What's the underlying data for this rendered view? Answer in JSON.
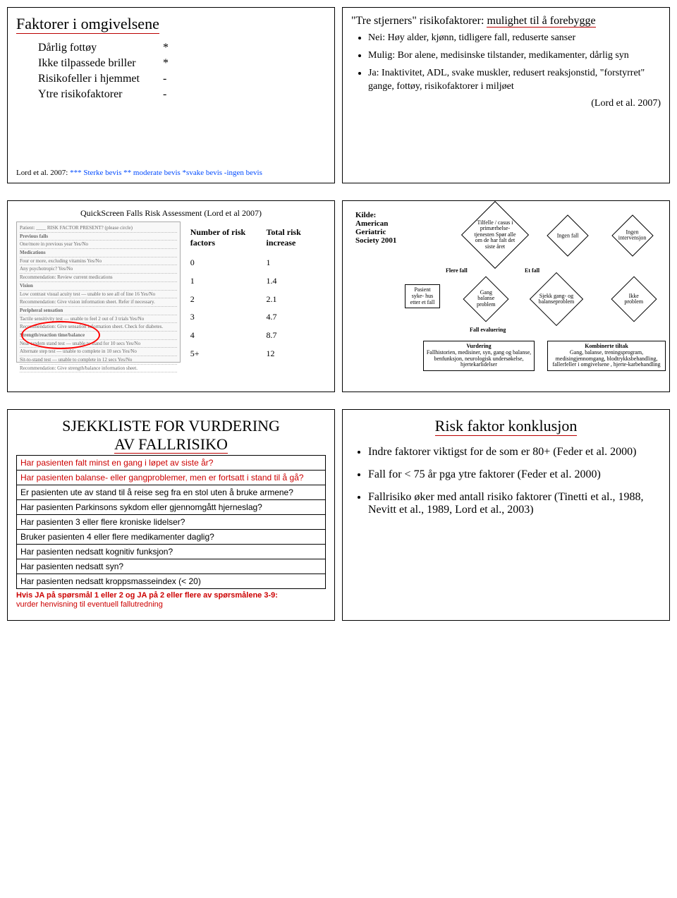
{
  "s1": {
    "title": "Faktorer i omgivelsene",
    "rows": [
      {
        "l": "Dårlig fottøy",
        "m": "*"
      },
      {
        "l": "Ikke tilpassede briller",
        "m": "*"
      },
      {
        "l": "Risikofeller i hjemmet",
        "m": "-"
      },
      {
        "l": "Ytre risikofaktorer",
        "m": "-"
      }
    ],
    "legend_a": "Lord et al. 2007: ",
    "legend_b": "*** Sterke bevis  ** moderate bevis  *svake bevis -ingen bevis"
  },
  "s2": {
    "title_pre": "\"Tre stjerners\" risikofaktorer: ",
    "title_ul": "mulighet til å forebygge",
    "items": [
      "Nei: Høy alder, kjønn, tidligere fall, reduserte sanser",
      "Mulig: Bor alene, medisinske tilstander, medikamenter, dårlig syn",
      "Ja: Inaktivitet, ADL, svake muskler, redusert reaksjonstid, \"forstyrret\" gange, fottøy, risikofaktorer i miljøet"
    ],
    "cite": "(Lord et al. 2007)"
  },
  "s3": {
    "title": "QuickScreen Falls Risk Assessment (Lord et al 2007)",
    "head_a": "Number of risk factors",
    "head_b": "Total risk increase",
    "chart_data": {
      "type": "table",
      "title": "QuickScreen Falls Risk Assessment — risk increase by number of risk factors",
      "xlabel": "Number of risk factors",
      "ylabel": "Total risk increase",
      "categories": [
        "0",
        "1",
        "2",
        "3",
        "4",
        "5+"
      ],
      "values": [
        1.0,
        1.4,
        2.1,
        4.7,
        8.7,
        12
      ]
    }
  },
  "s4": {
    "kilde": "Kilde: American Geriatric Society 2001",
    "d1": "Tilfelle / casus i primærhelse-\ntjenesten\nSpør alle om de har falt det siste året",
    "d2": "Ingen fall",
    "d3": "Ingen intervensjon",
    "l_flere": "Flere fall",
    "l_et": "Et fall",
    "b_pas": "Pasient syke-\nhus etter et  fall",
    "d4": "Gang balanse problem",
    "d5": "Sjekk gang- og balanseproblem",
    "d6": "Ikke problem",
    "l_fall": "Fall evaluering",
    "b_vur_t": "Vurdering",
    "b_vur": "Fallhistorien, medisiner, syn, gang og balanse, benfunksjon, neurologisk undersøkelse, hjertekarlidelser",
    "b_kom_t": "Kombinerte tiltak",
    "b_kom": "Gang, balanse, treningsprogram, medisingjennomgang, blodtrykksbehandling, fallerfeller i omgivelsene , hjerte-karbehandling"
  },
  "s5": {
    "title_a": "SJEKKLISTE FOR VURDERING",
    "title_b": "AV FALLRISIKO",
    "rows": [
      {
        "t": "Har pasienten falt minst en gang i løpet av siste år?",
        "red": true
      },
      {
        "t": "Har pasienten balanse- eller gangproblemer, men er fortsatt i stand til å gå?",
        "red": true
      },
      {
        "t": "Er pasienten ute av stand til å reise seg fra en stol uten å bruke armene?",
        "red": false
      },
      {
        "t": "Har pasienten Parkinsons sykdom eller gjennomgått hjerneslag?",
        "red": false
      },
      {
        "t": "Har pasienten 3 eller flere kroniske lidelser?",
        "red": false
      },
      {
        "t": "Bruker pasienten 4 eller flere medikamenter daglig?",
        "red": false
      },
      {
        "t": "Har pasienten nedsatt kognitiv funksjon?",
        "red": false
      },
      {
        "t": "Har pasienten nedsatt syn?",
        "red": false
      },
      {
        "t": "Har pasienten nedsatt kroppsmasseindex (< 20)",
        "red": false
      }
    ],
    "ftr1": "Hvis JA på spørsmål 1 eller 2  og  JA på 2 eller flere av spørsmålene 3-9:",
    "ftr2": "vurder henvisning til eventuell fallutredning"
  },
  "s6": {
    "title": "Risk faktor konklusjon",
    "items": [
      "Indre faktorer viktigst for de som er 80+ (Feder et al. 2000)",
      "Fall for < 75 år pga ytre faktorer (Feder et al. 2000)",
      "Fallrisiko øker med antall risiko faktorer (Tinetti et al., 1988, Nevitt et al., 1989, Lord et al., 2003)"
    ]
  }
}
